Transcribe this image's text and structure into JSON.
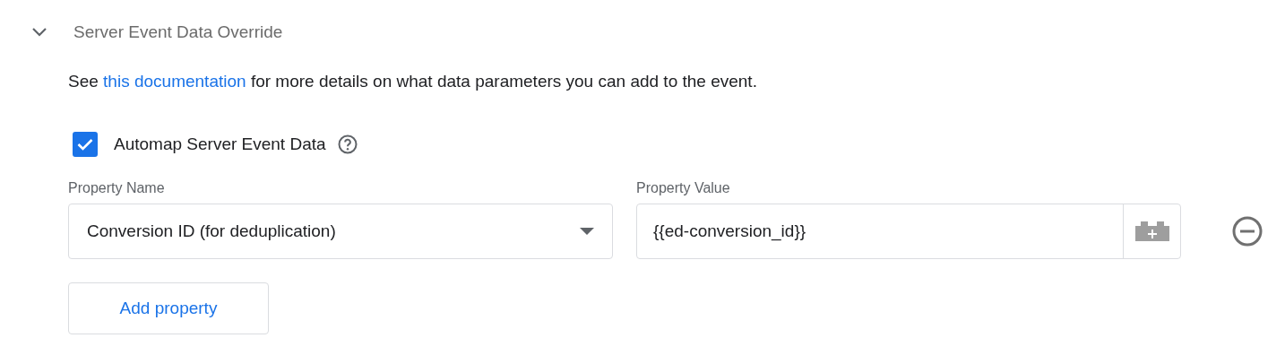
{
  "section": {
    "title": "Server Event Data Override",
    "expanded": true
  },
  "description": {
    "before": "See",
    "link": "this documentation",
    "after": "for more details on what data parameters you can add to the event."
  },
  "automap": {
    "label": "Automap Server Event Data",
    "checked": true
  },
  "columns": [
    "Property Name",
    "Property Value"
  ],
  "rows": [
    {
      "name": "Conversion ID (for deduplication)",
      "value": "{{ed-conversion_id}}"
    }
  ],
  "add_button": "Add property"
}
